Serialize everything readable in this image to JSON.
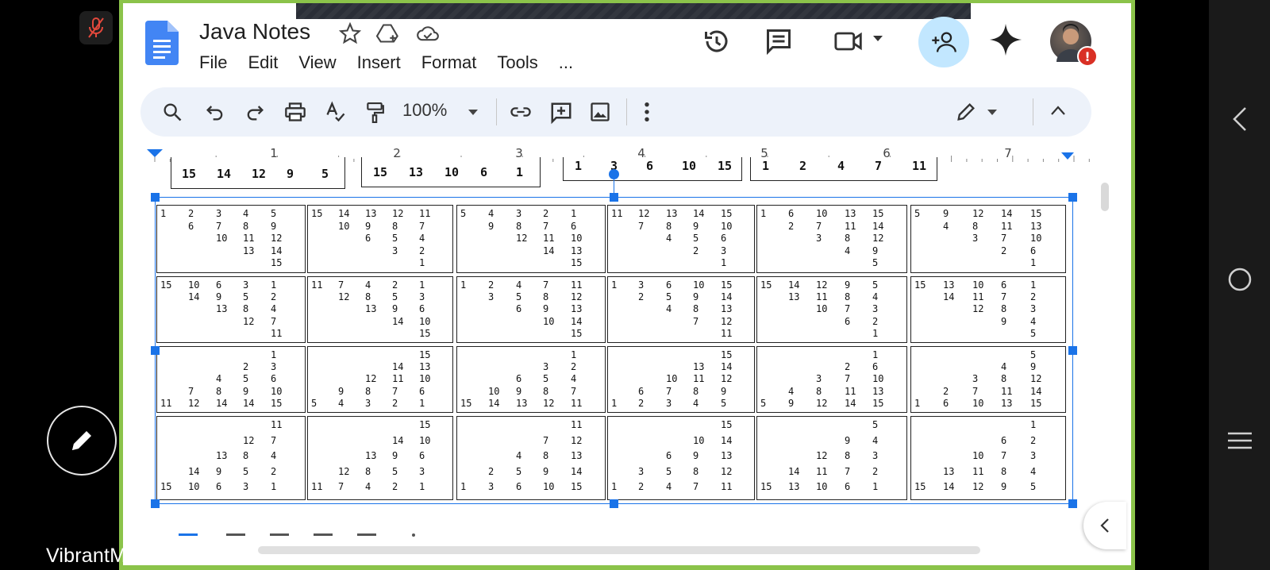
{
  "doc": {
    "title": "Java Notes",
    "menu": [
      "File",
      "Edit",
      "View",
      "Insert",
      "Format",
      "Tools",
      "..."
    ]
  },
  "toolbar": {
    "zoom": "100%"
  },
  "ruler": {
    "numbers": [
      "1",
      "2",
      "3",
      "4",
      "5",
      "6",
      "7"
    ]
  },
  "top_row_fragments": [
    [
      "15",
      "14",
      "12",
      "9",
      "5"
    ],
    [
      "15",
      "13",
      "10",
      "6",
      "1"
    ],
    [
      "1",
      "3",
      "6",
      "10",
      "15"
    ],
    [
      "1",
      "2",
      "4",
      "7",
      "11"
    ]
  ],
  "grid_rows": [
    [
      [
        [
          "1",
          "2",
          "3",
          "4",
          "5"
        ],
        [
          "6",
          "7",
          "8",
          "9"
        ],
        [
          "10",
          "11",
          "12"
        ],
        [
          "13",
          "14"
        ],
        [
          "15"
        ]
      ],
      [
        [
          "15",
          "14",
          "13",
          "12",
          "11"
        ],
        [
          "10",
          "9",
          "8",
          "7"
        ],
        [
          "6",
          "5",
          "4"
        ],
        [
          "3",
          "2"
        ],
        [
          "1"
        ]
      ],
      [
        [
          "5",
          "4",
          "3",
          "2",
          "1"
        ],
        [
          "9",
          "8",
          "7",
          "6"
        ],
        [
          "12",
          "11",
          "10"
        ],
        [
          "14",
          "13"
        ],
        [
          "15"
        ]
      ],
      [
        [
          "11",
          "12",
          "13",
          "14",
          "15"
        ],
        [
          "7",
          "8",
          "9",
          "10"
        ],
        [
          "4",
          "5",
          "6"
        ],
        [
          "2",
          "3"
        ],
        [
          "1"
        ]
      ],
      [
        [
          "1",
          "6",
          "10",
          "13",
          "15"
        ],
        [
          "2",
          "7",
          "11",
          "14"
        ],
        [
          "3",
          "8",
          "12"
        ],
        [
          "4",
          "9"
        ],
        [
          "5"
        ]
      ],
      [
        [
          "5",
          "9",
          "12",
          "14",
          "15"
        ],
        [
          "4",
          "8",
          "11",
          "13"
        ],
        [
          "3",
          "7",
          "10"
        ],
        [
          "2",
          "6"
        ],
        [
          "1"
        ]
      ]
    ],
    [
      [
        [
          "15",
          "10",
          "6",
          "3",
          "1"
        ],
        [
          "14",
          "9",
          "5",
          "2"
        ],
        [
          "13",
          "8",
          "4"
        ],
        [
          "12",
          "7"
        ],
        [
          "11"
        ]
      ],
      [
        [
          "11",
          "7",
          "4",
          "2",
          "1"
        ],
        [
          "12",
          "8",
          "5",
          "3"
        ],
        [
          "13",
          "9",
          "6"
        ],
        [
          "14",
          "10"
        ],
        [
          "15"
        ]
      ],
      [
        [
          "1",
          "2",
          "4",
          "7",
          "11"
        ],
        [
          "3",
          "5",
          "8",
          "12"
        ],
        [
          "6",
          "9",
          "13"
        ],
        [
          "10",
          "14"
        ],
        [
          "15"
        ]
      ],
      [
        [
          "1",
          "3",
          "6",
          "10",
          "15"
        ],
        [
          "2",
          "5",
          "9",
          "14"
        ],
        [
          "4",
          "8",
          "13"
        ],
        [
          "7",
          "12"
        ],
        [
          "11"
        ]
      ],
      [
        [
          "15",
          "14",
          "12",
          "9",
          "5"
        ],
        [
          "13",
          "11",
          "8",
          "4"
        ],
        [
          "10",
          "7",
          "3"
        ],
        [
          "6",
          "2"
        ],
        [
          "1"
        ]
      ],
      [
        [
          "15",
          "13",
          "10",
          "6",
          "1"
        ],
        [
          "14",
          "11",
          "7",
          "2"
        ],
        [
          "12",
          "8",
          "3"
        ],
        [
          "9",
          "4"
        ],
        [
          "5"
        ]
      ]
    ],
    [
      [
        [
          "1"
        ],
        [
          "2",
          "3"
        ],
        [
          "4",
          "5",
          "6"
        ],
        [
          "7",
          "8",
          "9",
          "10"
        ],
        [
          "11",
          "12",
          "14",
          "14",
          "15"
        ]
      ],
      [
        [
          "15"
        ],
        [
          "14",
          "13"
        ],
        [
          "12",
          "11",
          "10"
        ],
        [
          "9",
          "8",
          "7",
          "6"
        ],
        [
          "5",
          "4",
          "3",
          "2",
          "1"
        ]
      ],
      [
        [
          "1"
        ],
        [
          "3",
          "2"
        ],
        [
          "6",
          "5",
          "4"
        ],
        [
          "10",
          "9",
          "8",
          "7"
        ],
        [
          "15",
          "14",
          "13",
          "12",
          "11"
        ]
      ],
      [
        [
          "15"
        ],
        [
          "13",
          "14"
        ],
        [
          "10",
          "11",
          "12"
        ],
        [
          "6",
          "7",
          "8",
          "9"
        ],
        [
          "1",
          "2",
          "3",
          "4",
          "5"
        ]
      ],
      [
        [
          "1"
        ],
        [
          "2",
          "6"
        ],
        [
          "3",
          "7",
          "10"
        ],
        [
          "4",
          "8",
          "11",
          "13"
        ],
        [
          "5",
          "9",
          "12",
          "14",
          "15"
        ]
      ],
      [
        [
          "5"
        ],
        [
          "4",
          "9"
        ],
        [
          "3",
          "8",
          "12"
        ],
        [
          "2",
          "7",
          "11",
          "14"
        ],
        [
          "1",
          "6",
          "10",
          "13",
          "15"
        ]
      ]
    ],
    [
      [
        [
          "11"
        ],
        [
          "12",
          "7"
        ],
        [
          "13",
          "8",
          "4"
        ],
        [
          "14",
          "9",
          "5",
          "2"
        ],
        [
          "15",
          "10",
          "6",
          "3",
          "1"
        ]
      ],
      [
        [
          "15"
        ],
        [
          "14",
          "10"
        ],
        [
          "13",
          "9",
          "6"
        ],
        [
          "12",
          "8",
          "5",
          "3"
        ],
        [
          "11",
          "7",
          "4",
          "2",
          "1"
        ]
      ],
      [
        [
          "11"
        ],
        [
          "7",
          "12"
        ],
        [
          "4",
          "8",
          "13"
        ],
        [
          "2",
          "5",
          "9",
          "14"
        ],
        [
          "1",
          "3",
          "6",
          "10",
          "15"
        ]
      ],
      [
        [
          "15"
        ],
        [
          "10",
          "14"
        ],
        [
          "6",
          "9",
          "13"
        ],
        [
          "3",
          "5",
          "8",
          "12"
        ],
        [
          "1",
          "2",
          "4",
          "7",
          "11"
        ]
      ],
      [
        [
          "5"
        ],
        [
          "9",
          "4"
        ],
        [
          "12",
          "8",
          "3"
        ],
        [
          "14",
          "11",
          "7",
          "2"
        ],
        [
          "15",
          "13",
          "10",
          "6",
          "1"
        ]
      ],
      [
        [
          "1"
        ],
        [
          "6",
          "2"
        ],
        [
          "10",
          "7",
          "3"
        ],
        [
          "13",
          "11",
          "8",
          "4"
        ],
        [
          "15",
          "14",
          "12",
          "9",
          "5"
        ]
      ]
    ]
  ],
  "caption": "VibrantMinds’ screen"
}
